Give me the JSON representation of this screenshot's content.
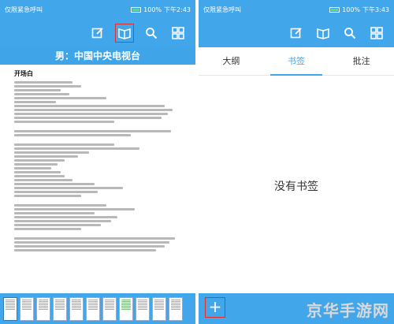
{
  "left": {
    "status": {
      "left_text": "仅限紧急呼叫",
      "battery": "100%",
      "time": "下午2:43"
    },
    "doc_title": "男：中国中央电视台",
    "doc_heading": "开场白"
  },
  "right": {
    "status": {
      "left_text": "仅限紧急呼叫",
      "battery": "100%",
      "time": "下午3:43"
    },
    "tabs": [
      "大纲",
      "书签",
      "批注"
    ],
    "empty_message": "没有书签",
    "add_label": "+"
  },
  "icons": [
    "edit-icon",
    "book-icon",
    "search-icon",
    "grid-icon"
  ],
  "watermark": "京华手游网",
  "colors": {
    "primary": "#42a6ea",
    "highlight": "#e0302d"
  }
}
